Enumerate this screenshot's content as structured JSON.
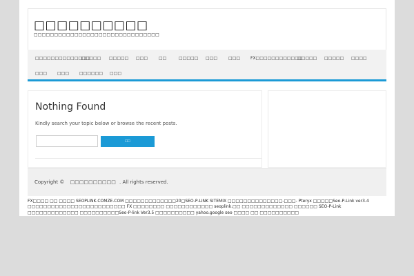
{
  "header": {
    "site_title": "□□□□□□□□□□",
    "site_description": "□□□□□□□□□□□□□□□□□□□□□□□□□□□□□□□"
  },
  "nav": {
    "items": [
      "□□□□□□□□□□□□□□",
      "□□□□□",
      "□□□□□",
      "□□□",
      "□□",
      "□□□□□",
      "□□□",
      "□□□",
      "FX□□□□□□□□□□□□",
      "□□□□□",
      "□□□□□",
      "□□□□",
      "□□□",
      "□□□",
      "□□□□□□",
      "□□□"
    ]
  },
  "main": {
    "title": "Nothing Found",
    "message": "Kindly search your topic below or browse the recent posts.",
    "search": {
      "value": "",
      "button_label": "□□"
    }
  },
  "footer": {
    "copyright_prefix": "Copyright ©",
    "site_name": "□□□□□□□□□□",
    "rights": ". All rights reserved."
  },
  "links_text": "FX□□□□ □□ □□□□ SEOPLINK.COMZE.COM □□□□□□□□□□□□□20□SEO-P-LINK SITEMIX □□□□□□□□□□□□□□-□□□- Pteryx □□□□□Seo-P-Link ver3.4 □□□□□□□□□□□□□□□□□□□□□□□□□ FX □□□□□□□□ □□□□□□□□□□□□ seoplink.□□ □□□□□□□□□□□□□ □□□□□□ SEO-P-Link □□□□□□□□□□□□□ □□□□□□□□□□Seo-P-link Ver3.5 □□□□□□□□□□ yahoo.google seo □□□□ □□ □□□□□□□□□□"
}
